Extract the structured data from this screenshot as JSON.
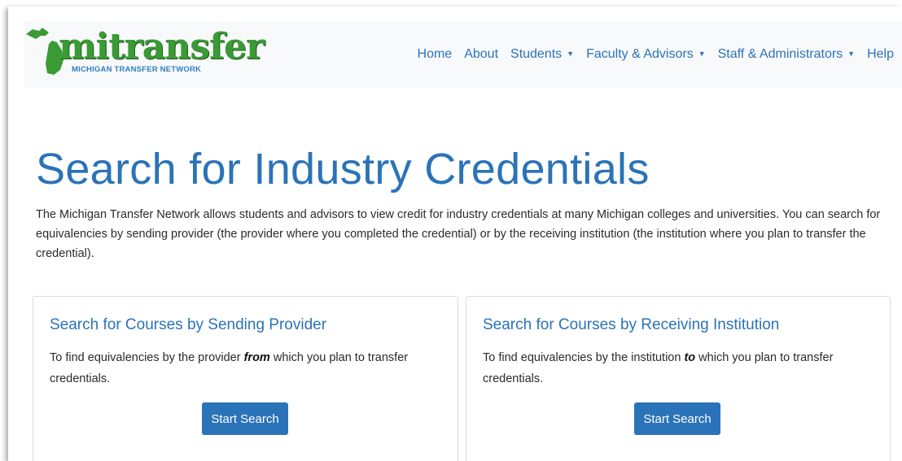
{
  "logo": {
    "word": "mitransfer",
    "subtitle": "MICHIGAN TRANSFER NETWORK"
  },
  "nav": {
    "items": [
      {
        "label": "Home",
        "dropdown": false
      },
      {
        "label": "About",
        "dropdown": false
      },
      {
        "label": "Students",
        "dropdown": true
      },
      {
        "label": "Faculty & Advisors",
        "dropdown": true
      },
      {
        "label": "Staff & Administrators",
        "dropdown": true
      },
      {
        "label": "Help",
        "dropdown": false
      }
    ],
    "caret": "▼"
  },
  "page": {
    "title": "Search for Industry Credentials",
    "intro": "The Michigan Transfer Network allows students and advisors to view credit for industry credentials at many Michigan colleges and universities.  You can search for equivalencies by sending provider (the provider where you completed the credential) or by the receiving institution (the institution where you plan to transfer the credential)."
  },
  "cards": [
    {
      "title": "Search for Courses by Sending Provider",
      "text_before": "To find equivalencies by the provider ",
      "emphasis": "from",
      "text_after": " which you plan to transfer credentials.",
      "button": "Start Search"
    },
    {
      "title": "Search for Courses by Receiving Institution",
      "text_before": "To find equivalencies by the institution ",
      "emphasis": "to",
      "text_after": " which you plan to transfer credentials.",
      "button": "Start Search"
    }
  ],
  "colors": {
    "brand_blue": "#2a73b8",
    "logo_green": "#3a9b35"
  }
}
